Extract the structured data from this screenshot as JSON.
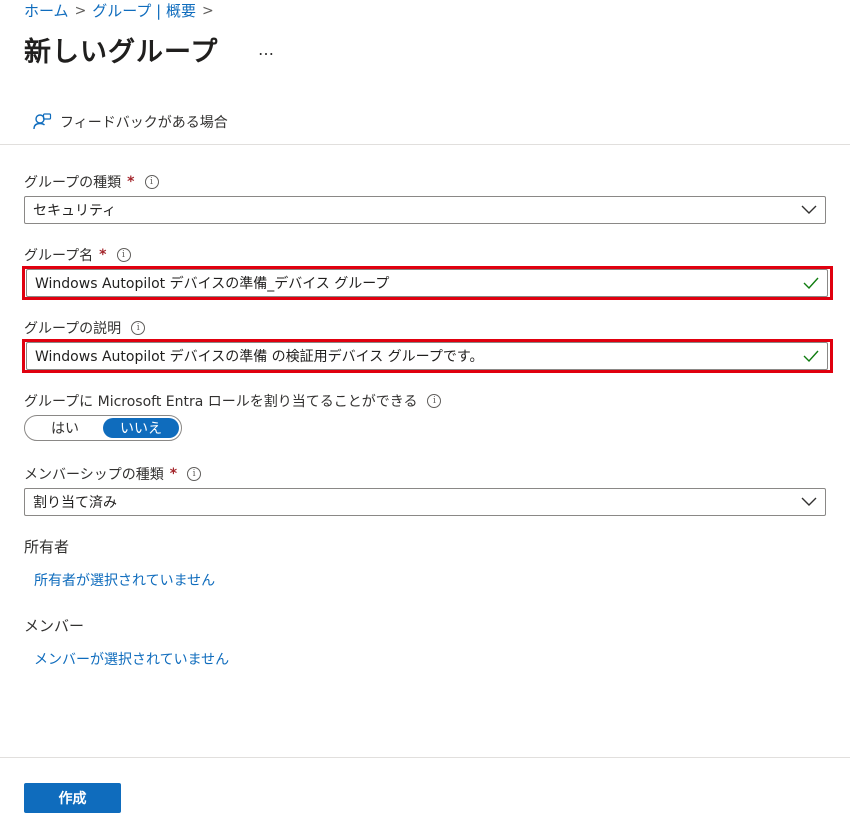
{
  "breadcrumb": {
    "items": [
      "ホーム",
      "グループ | 概要"
    ]
  },
  "header": {
    "title": "新しいグループ",
    "more": "…"
  },
  "feedback": {
    "label": "フィードバックがある場合"
  },
  "group_type": {
    "label": "グループの種類",
    "required": "*",
    "value": "セキュリティ"
  },
  "group_name": {
    "label": "グループ名",
    "required": "*",
    "value": "Windows Autopilot デバイスの準備_デバイス グループ"
  },
  "group_desc": {
    "label": "グループの説明",
    "value": "Windows Autopilot デバイスの準備 の検証用デバイス グループです。"
  },
  "entra_role": {
    "label": "グループに Microsoft Entra ロールを割り当てることができる",
    "options": [
      "はい",
      "いいえ"
    ],
    "selected": "いいえ"
  },
  "membership": {
    "label": "メンバーシップの種類",
    "required": "*",
    "value": "割り当て済み"
  },
  "owners": {
    "label": "所有者",
    "link": "所有者が選択されていません"
  },
  "members": {
    "label": "メンバー",
    "link": "メンバーが選択されていません"
  },
  "actions": {
    "create": "作成"
  },
  "colors": {
    "accent": "#0f6cbd",
    "highlight": "#e0000f",
    "required": "#a4262c",
    "valid": "#107c10"
  }
}
